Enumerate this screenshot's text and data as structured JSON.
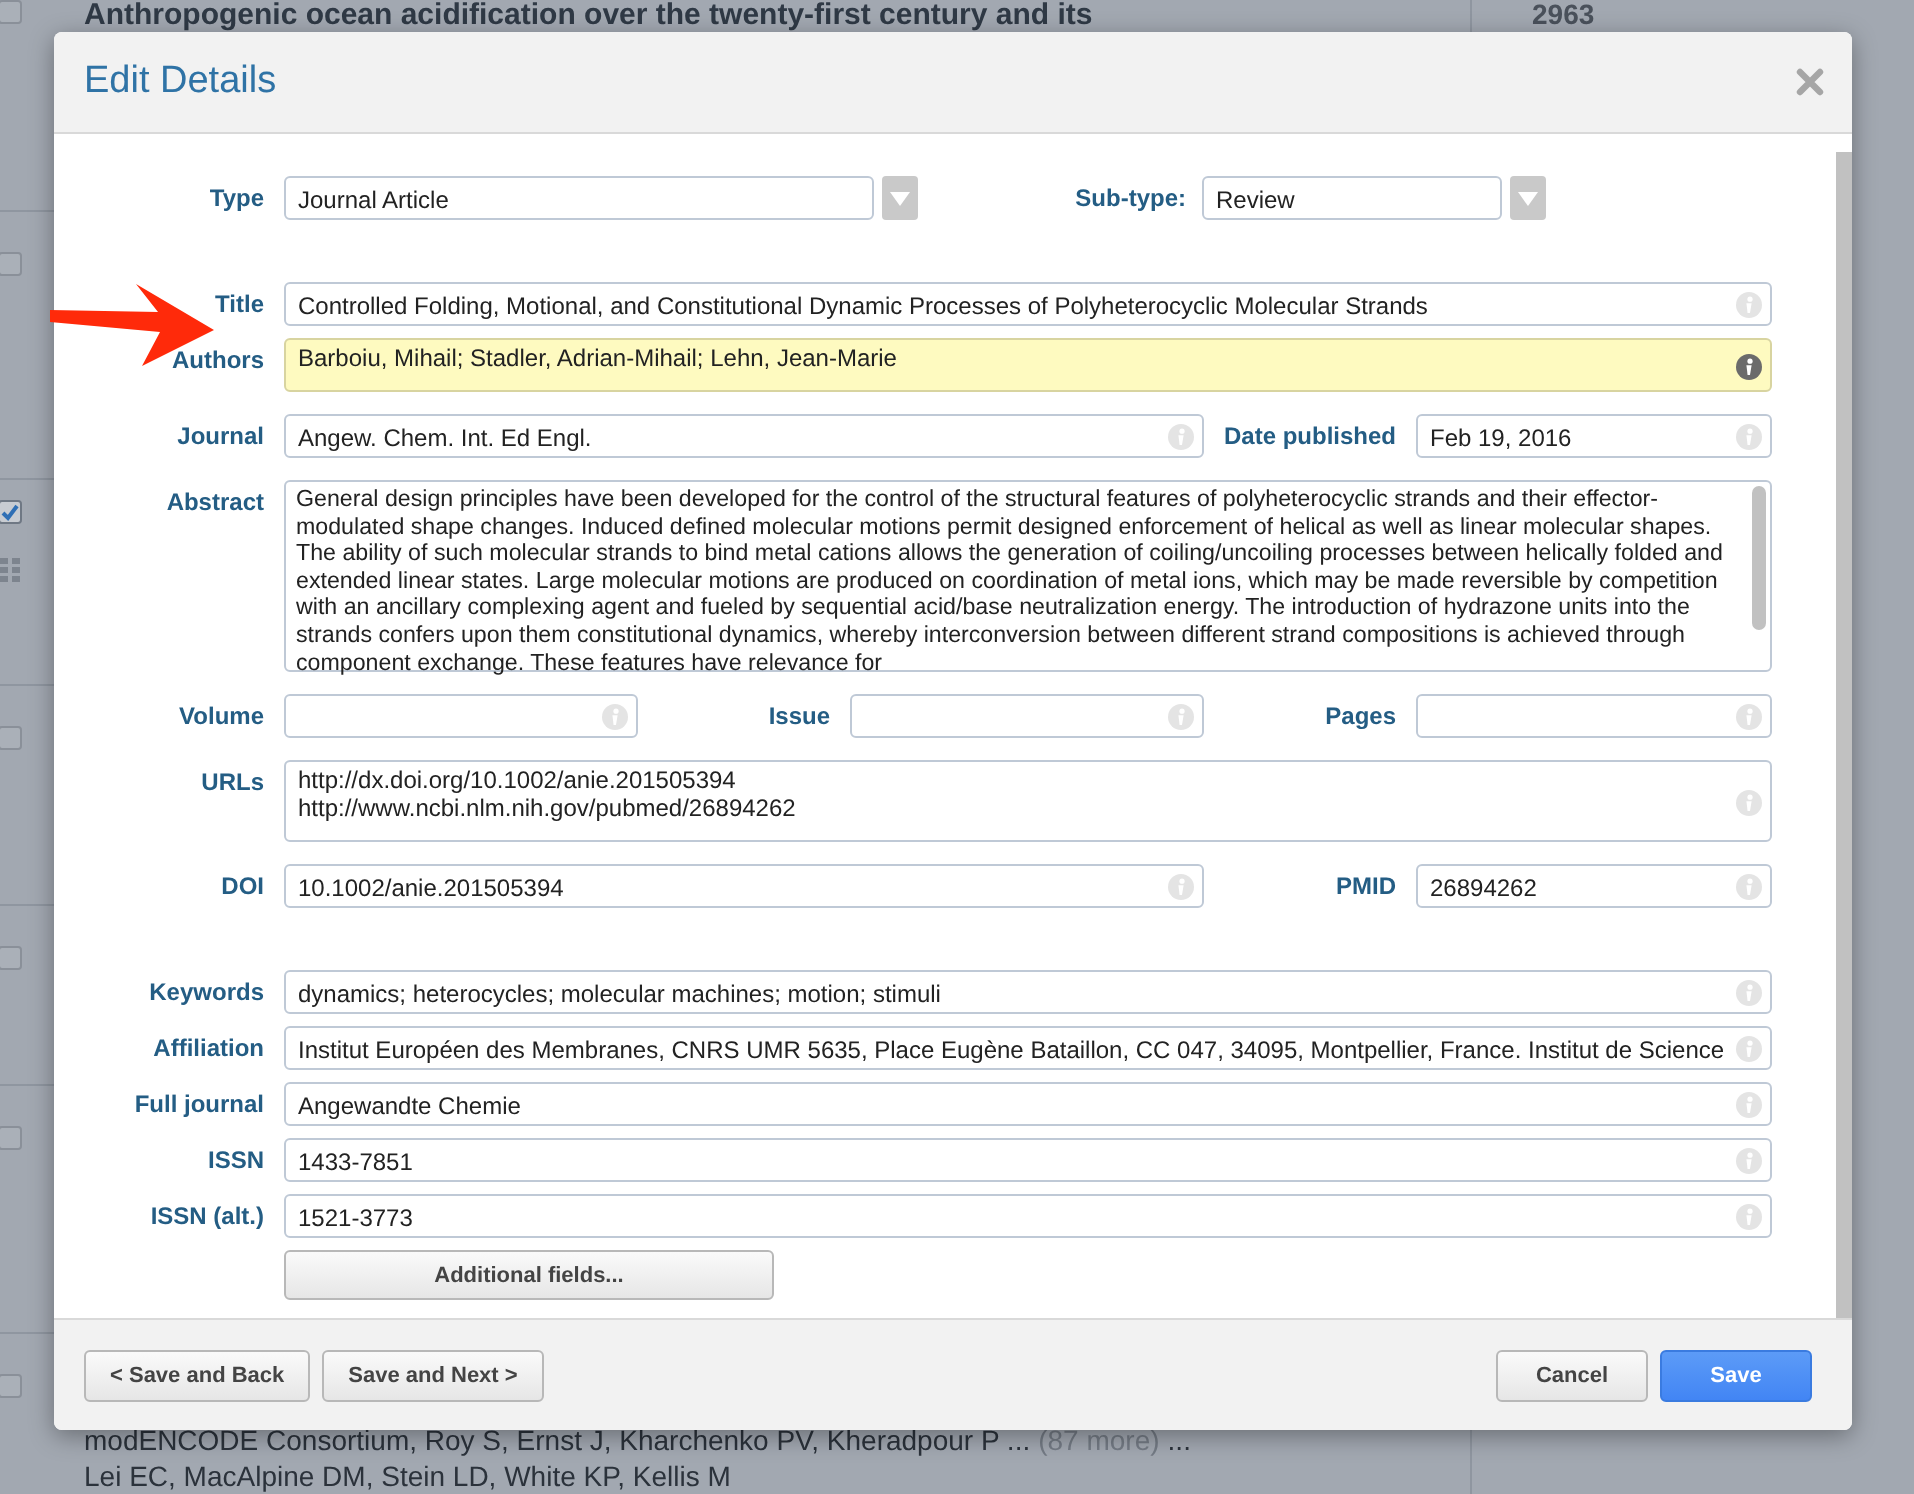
{
  "background_page": {
    "heading_lines": [
      "Anthropogenic ocean acidification over the twenty-first century and its"
    ],
    "count": "2963",
    "results": [
      {
        "checked": false
      },
      {
        "checked": false
      },
      {
        "checked": true
      },
      {
        "checked": false
      },
      {
        "checked": false
      },
      {
        "checked": false
      },
      {
        "checked": false
      }
    ],
    "authors_line": "modENCODE Consortium, Roy S, Ernst J, Kharchenko PV, Kheradpour P ...",
    "more_link": "(87 more)",
    "authors_tail": "...",
    "authors_line_2": "Lei EC, MacAlpine DM, Stein LD, White KP, Kellis M"
  },
  "dialog": {
    "title": "Edit Details",
    "type": {
      "label": "Type",
      "value": "Journal Article"
    },
    "subtype": {
      "label": "Sub-type:",
      "value": "Review"
    },
    "sections": [
      {
        "rows": [
          [
            {
              "label": "Title",
              "value": "Controlled Folding, Motional, and Constitutional Dynamic Processes of Polyheterocyclic Molecular Strands",
              "kind": "text",
              "focused": false
            }
          ],
          [
            {
              "label": "Authors",
              "value": "Barboiu, Mihail; Stadler, Adrian-Mihail; Lehn, Jean-Marie",
              "kind": "tall",
              "focused": true
            }
          ]
        ]
      },
      {
        "rows": [
          [
            {
              "label": "Journal",
              "value": "Angew. Chem. Int. Ed Engl.",
              "kind": "text",
              "focused": false
            },
            {
              "label": "Date published",
              "value": "Feb 19, 2016",
              "kind": "text",
              "focused": false
            }
          ],
          [
            {
              "label": "Abstract",
              "value": "General design principles have been developed for the control of the structural features of polyheterocyclic strands and their effector-modulated shape changes. Induced defined molecular motions permit designed enforcement of helical as well as linear molecular shapes. The ability of such molecular strands to bind metal cations allows the generation of coiling/uncoiling processes between helically folded and extended linear states. Large molecular motions are produced on coordination of metal ions, which may be made reversible by competition with an ancillary complexing agent and fueled by sequential acid/base neutralization energy. The introduction of hydrazone units into the strands confers upon them constitutional dynamics, whereby interconversion between different strand compositions is achieved through component exchange. These features have relevance for",
              "kind": "scroll",
              "focused": false
            }
          ],
          [
            {
              "label": "Volume",
              "kind": "text",
              "focused": false
            },
            {
              "label": "Issue",
              "kind": "text",
              "focused": false
            },
            {
              "label": "Pages",
              "kind": "text",
              "focused": false
            }
          ],
          [
            {
              "label": "URLs",
              "value": "http://dx.doi.org/10.1002/anie.201505394\nhttp://www.ncbi.nlm.nih.gov/pubmed/26894262",
              "kind": "multiline",
              "focused": false
            }
          ],
          [
            {
              "label": "DOI",
              "value": "10.1002/anie.201505394",
              "kind": "text",
              "focused": false
            },
            {
              "label": "PMID",
              "value": "26894262",
              "kind": "text",
              "focused": false
            }
          ]
        ]
      },
      {
        "rows": [
          [
            {
              "label": "Keywords",
              "value": "dynamics; heterocycles; molecular machines; motion; stimuli",
              "kind": "text",
              "focused": false
            }
          ],
          [
            {
              "label": "Affiliation",
              "value": "Institut Européen des Membranes, CNRS UMR 5635, Place Eugène Bataillon, CC 047, 34095, Montpellier, France. Institut de Science",
              "kind": "text",
              "focused": false
            }
          ],
          [
            {
              "label": "Full journal",
              "value": "Angewandte Chemie",
              "kind": "text",
              "focused": false
            }
          ],
          [
            {
              "label": "ISSN",
              "value": "1433-7851",
              "kind": "text",
              "focused": false
            }
          ],
          [
            {
              "label": "ISSN (alt.)",
              "value": "1521-3773",
              "kind": "text",
              "focused": false
            }
          ]
        ]
      }
    ],
    "additional_button": "Additional fields...",
    "footer_left": [
      "< Save and Back",
      "Save and Next >"
    ],
    "footer_right": [
      {
        "label": "Cancel",
        "primary": false
      },
      {
        "label": "Save",
        "primary": true
      }
    ]
  }
}
